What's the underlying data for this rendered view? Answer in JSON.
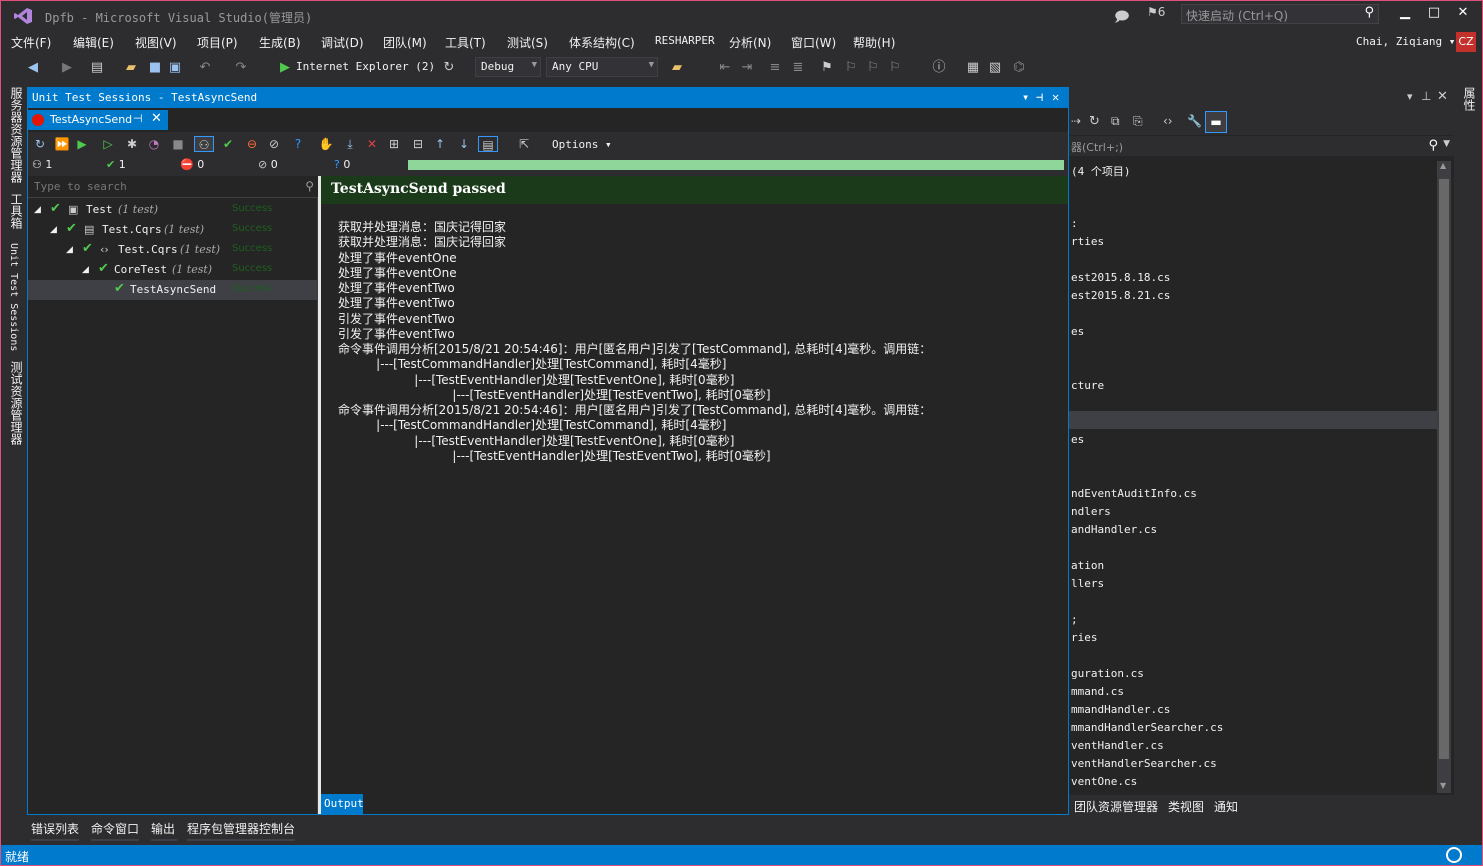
{
  "window": {
    "title": "Dpfb - Microsoft Visual Studio(管理员)",
    "notif_count": "6",
    "quick_launch_placeholder": "快速启动 (Ctrl+Q)",
    "min": "▁",
    "max": "□",
    "close": "✕"
  },
  "menu": [
    "文件(F)",
    "编辑(E)",
    "视图(V)",
    "项目(P)",
    "生成(B)",
    "调试(D)",
    "团队(M)",
    "工具(T)",
    "测试(S)",
    "体系结构(C)",
    "RESHARPER",
    "分析(N)",
    "窗口(W)",
    "帮助(H)"
  ],
  "user": {
    "name": "Chai, Ziqiang ▾",
    "initials": "CZ"
  },
  "toolbar": {
    "run_target": "Internet Explorer (2)",
    "config": "Debug",
    "platform": "Any CPU"
  },
  "left_dock": [
    "服务器资源管理器",
    "工具箱",
    "Unit Test Sessions",
    "测试资源管理器"
  ],
  "right_dock": [
    "属性"
  ],
  "unit_test": {
    "panel_title": "Unit Test Sessions - TestAsyncSend",
    "tab_label": "TestAsyncSend",
    "options_label": "Options ▾",
    "counts": {
      "total": "1",
      "passed": "1",
      "failed": "0",
      "ignored": "0",
      "unknown": "0"
    },
    "search_placeholder": "Type to search",
    "tree": [
      {
        "name": "Test",
        "count": "(1 test)",
        "status": "Success"
      },
      {
        "name": "Test.Cqrs",
        "count": "(1 test)",
        "status": "Success"
      },
      {
        "name": "Test.Cqrs",
        "count": "(1 test)",
        "status": "Success"
      },
      {
        "name": "CoreTest",
        "count": "(1 test)",
        "status": "Success"
      },
      {
        "name": "TestAsyncSend",
        "count": "",
        "status": "Success"
      }
    ],
    "result_title": "TestAsyncSend passed",
    "output_lines": [
      "获取并处理消息：国庆记得回家",
      "获取并处理消息：国庆记得回家",
      "处理了事件eventOne",
      "处理了事件eventOne",
      "处理了事件eventTwo",
      "处理了事件eventTwo",
      "引发了事件eventTwo",
      "引发了事件eventTwo",
      "命令事件调用分析[2015/8/21 20:54:46]：用户[匿名用户]引发了[TestCommand], 总耗时[4]毫秒。调用链：",
      "          |---[TestCommandHandler]处理[TestCommand], 耗时[4毫秒]",
      "                    |---[TestEventHandler]处理[TestEventOne], 耗时[0毫秒]",
      "                              |---[TestEventHandler]处理[TestEventTwo], 耗时[0毫秒]",
      "命令事件调用分析[2015/8/21 20:54:46]：用户[匿名用户]引发了[TestCommand], 总耗时[4]毫秒。调用链：",
      "          |---[TestCommandHandler]处理[TestCommand], 耗时[4毫秒]",
      "                    |---[TestEventHandler]处理[TestEventOne], 耗时[0毫秒]",
      "                              |---[TestEventHandler]处理[TestEventTwo], 耗时[0毫秒]"
    ],
    "output_tab": "Output"
  },
  "solution": {
    "search_placeholder": "器(Ctrl+;)",
    "lines": [
      "(4 个项目)",
      ":",
      "rties",
      "est2015.8.18.cs",
      "est2015.8.21.cs",
      "es",
      "cture",
      "",
      "es",
      "ndEventAuditInfo.cs",
      "ndlers",
      "andHandler.cs",
      "ation",
      "llers",
      ";",
      "ries",
      "guration.cs",
      "mmand.cs",
      "mmandHandler.cs",
      "mmandHandlerSearcher.cs",
      "ventHandler.cs",
      "ventHandlerSearcher.cs",
      "ventOne.cs"
    ],
    "tabs": [
      "团队资源管理器",
      "类视图",
      "通知"
    ]
  },
  "bottom_tabs": [
    "错误列表",
    "命令窗口",
    "输出",
    "程序包管理器控制台"
  ],
  "status_text": "就绪"
}
